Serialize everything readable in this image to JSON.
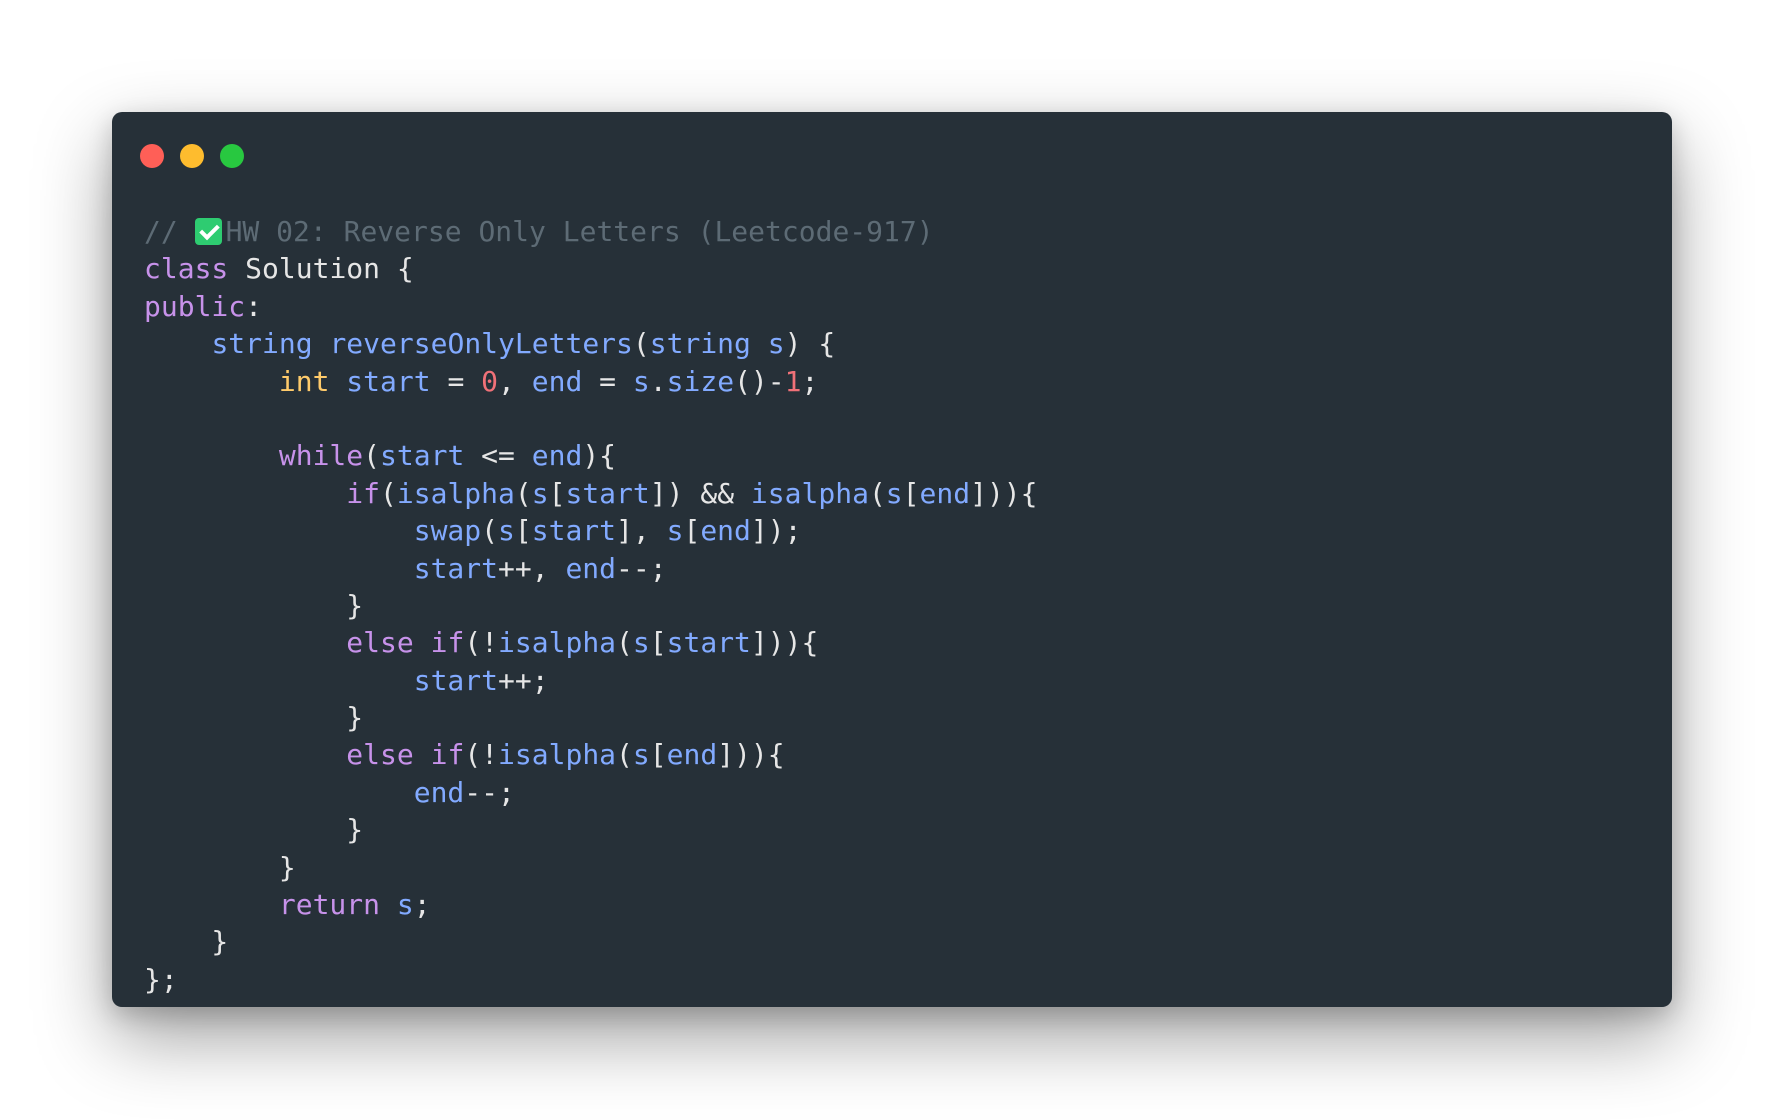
{
  "colors": {
    "background": "#263038",
    "comment": "#5d6b75",
    "keyword": "#c792ea",
    "type": "#82aaff",
    "function": "#82aaff",
    "variable": "#82aaff",
    "int_type": "#ffcb6b",
    "number": "#f07178",
    "plain": "#e6e6e6",
    "check_emoji": "#2ecc71"
  },
  "window_controls": [
    {
      "name": "close-button",
      "color": "#ff5f57"
    },
    {
      "name": "minimize-button",
      "color": "#febc2e"
    },
    {
      "name": "zoom-button",
      "color": "#28c840"
    }
  ],
  "code": {
    "language": "cpp",
    "lines": [
      [
        {
          "t": "// ",
          "c": "comment"
        },
        {
          "t": "",
          "c": "emoji",
          "icon": "check-mark-emoji-icon"
        },
        {
          "t": "HW 02: Reverse Only Letters (Leetcode-917)",
          "c": "comment"
        }
      ],
      [
        {
          "t": "class ",
          "c": "keyword"
        },
        {
          "t": "Solution {",
          "c": "plain"
        }
      ],
      [
        {
          "t": "public",
          "c": "keyword"
        },
        {
          "t": ":",
          "c": "plain"
        }
      ],
      [
        {
          "t": "    ",
          "c": "plain"
        },
        {
          "t": "string",
          "c": "type"
        },
        {
          "t": " ",
          "c": "plain"
        },
        {
          "t": "reverseOnlyLetters",
          "c": "function"
        },
        {
          "t": "(",
          "c": "plain"
        },
        {
          "t": "string",
          "c": "type"
        },
        {
          "t": " ",
          "c": "plain"
        },
        {
          "t": "s",
          "c": "variable"
        },
        {
          "t": ") {",
          "c": "plain"
        }
      ],
      [
        {
          "t": "        ",
          "c": "plain"
        },
        {
          "t": "int",
          "c": "int_type"
        },
        {
          "t": " ",
          "c": "plain"
        },
        {
          "t": "start",
          "c": "variable"
        },
        {
          "t": " = ",
          "c": "plain"
        },
        {
          "t": "0",
          "c": "number"
        },
        {
          "t": ", ",
          "c": "plain"
        },
        {
          "t": "end",
          "c": "variable"
        },
        {
          "t": " = ",
          "c": "plain"
        },
        {
          "t": "s",
          "c": "variable"
        },
        {
          "t": ".",
          "c": "plain"
        },
        {
          "t": "size",
          "c": "function"
        },
        {
          "t": "()-",
          "c": "plain"
        },
        {
          "t": "1",
          "c": "number"
        },
        {
          "t": ";",
          "c": "plain"
        }
      ],
      [
        {
          "t": "",
          "c": "plain"
        }
      ],
      [
        {
          "t": "        ",
          "c": "plain"
        },
        {
          "t": "while",
          "c": "keyword"
        },
        {
          "t": "(",
          "c": "plain"
        },
        {
          "t": "start",
          "c": "variable"
        },
        {
          "t": " <= ",
          "c": "plain"
        },
        {
          "t": "end",
          "c": "variable"
        },
        {
          "t": "){",
          "c": "plain"
        }
      ],
      [
        {
          "t": "            ",
          "c": "plain"
        },
        {
          "t": "if",
          "c": "keyword"
        },
        {
          "t": "(",
          "c": "plain"
        },
        {
          "t": "isalpha",
          "c": "function"
        },
        {
          "t": "(",
          "c": "plain"
        },
        {
          "t": "s",
          "c": "variable"
        },
        {
          "t": "[",
          "c": "plain"
        },
        {
          "t": "start",
          "c": "variable"
        },
        {
          "t": "]) && ",
          "c": "plain"
        },
        {
          "t": "isalpha",
          "c": "function"
        },
        {
          "t": "(",
          "c": "plain"
        },
        {
          "t": "s",
          "c": "variable"
        },
        {
          "t": "[",
          "c": "plain"
        },
        {
          "t": "end",
          "c": "variable"
        },
        {
          "t": "])){",
          "c": "plain"
        }
      ],
      [
        {
          "t": "                ",
          "c": "plain"
        },
        {
          "t": "swap",
          "c": "function"
        },
        {
          "t": "(",
          "c": "plain"
        },
        {
          "t": "s",
          "c": "variable"
        },
        {
          "t": "[",
          "c": "plain"
        },
        {
          "t": "start",
          "c": "variable"
        },
        {
          "t": "], ",
          "c": "plain"
        },
        {
          "t": "s",
          "c": "variable"
        },
        {
          "t": "[",
          "c": "plain"
        },
        {
          "t": "end",
          "c": "variable"
        },
        {
          "t": "]);",
          "c": "plain"
        }
      ],
      [
        {
          "t": "                ",
          "c": "plain"
        },
        {
          "t": "start",
          "c": "variable"
        },
        {
          "t": "++, ",
          "c": "plain"
        },
        {
          "t": "end",
          "c": "variable"
        },
        {
          "t": "--;",
          "c": "plain"
        }
      ],
      [
        {
          "t": "            }",
          "c": "plain"
        }
      ],
      [
        {
          "t": "            ",
          "c": "plain"
        },
        {
          "t": "else",
          "c": "keyword"
        },
        {
          "t": " ",
          "c": "plain"
        },
        {
          "t": "if",
          "c": "keyword"
        },
        {
          "t": "(!",
          "c": "plain"
        },
        {
          "t": "isalpha",
          "c": "function"
        },
        {
          "t": "(",
          "c": "plain"
        },
        {
          "t": "s",
          "c": "variable"
        },
        {
          "t": "[",
          "c": "plain"
        },
        {
          "t": "start",
          "c": "variable"
        },
        {
          "t": "])){",
          "c": "plain"
        }
      ],
      [
        {
          "t": "                ",
          "c": "plain"
        },
        {
          "t": "start",
          "c": "variable"
        },
        {
          "t": "++;",
          "c": "plain"
        }
      ],
      [
        {
          "t": "            }",
          "c": "plain"
        }
      ],
      [
        {
          "t": "            ",
          "c": "plain"
        },
        {
          "t": "else",
          "c": "keyword"
        },
        {
          "t": " ",
          "c": "plain"
        },
        {
          "t": "if",
          "c": "keyword"
        },
        {
          "t": "(!",
          "c": "plain"
        },
        {
          "t": "isalpha",
          "c": "function"
        },
        {
          "t": "(",
          "c": "plain"
        },
        {
          "t": "s",
          "c": "variable"
        },
        {
          "t": "[",
          "c": "plain"
        },
        {
          "t": "end",
          "c": "variable"
        },
        {
          "t": "])){",
          "c": "plain"
        }
      ],
      [
        {
          "t": "                ",
          "c": "plain"
        },
        {
          "t": "end",
          "c": "variable"
        },
        {
          "t": "--;",
          "c": "plain"
        }
      ],
      [
        {
          "t": "            }",
          "c": "plain"
        }
      ],
      [
        {
          "t": "        }",
          "c": "plain"
        }
      ],
      [
        {
          "t": "        ",
          "c": "plain"
        },
        {
          "t": "return",
          "c": "keyword"
        },
        {
          "t": " ",
          "c": "plain"
        },
        {
          "t": "s",
          "c": "variable"
        },
        {
          "t": ";",
          "c": "plain"
        }
      ],
      [
        {
          "t": "    }",
          "c": "plain"
        }
      ],
      [
        {
          "t": "};",
          "c": "plain"
        }
      ]
    ]
  }
}
